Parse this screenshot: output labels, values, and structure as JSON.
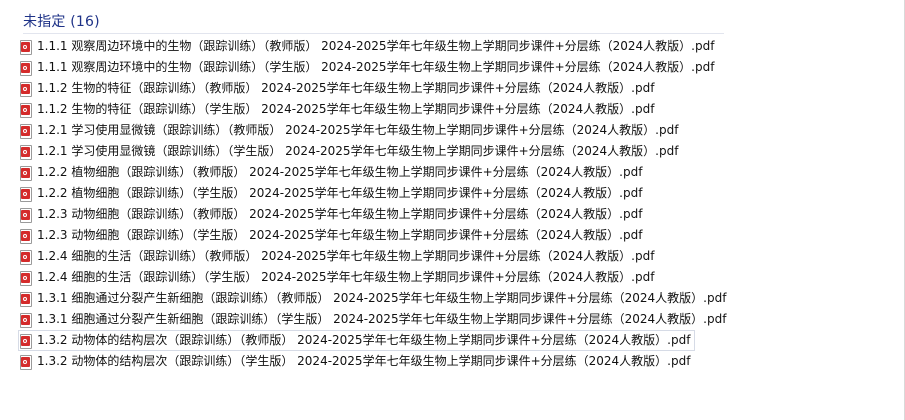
{
  "group": {
    "title": "未指定 (16)"
  },
  "files": [
    {
      "name": "1.1.1 观察周边环境中的生物（跟踪训练）（教师版） 2024-2025学年七年级生物上学期同步课件+分层练（2024人教版）.pdf",
      "icon": "pdf-icon"
    },
    {
      "name": "1.1.1 观察周边环境中的生物（跟踪训练）（学生版） 2024-2025学年七年级生物上学期同步课件+分层练（2024人教版）.pdf",
      "icon": "pdf-icon"
    },
    {
      "name": "1.1.2 生物的特征（跟踪训练）（教师版） 2024-2025学年七年级生物上学期同步课件+分层练（2024人教版）.pdf",
      "icon": "pdf-icon"
    },
    {
      "name": "1.1.2 生物的特征（跟踪训练）（学生版） 2024-2025学年七年级生物上学期同步课件+分层练（2024人教版）.pdf",
      "icon": "pdf-icon"
    },
    {
      "name": "1.2.1 学习使用显微镜（跟踪训练）（教师版） 2024-2025学年七年级生物上学期同步课件+分层练（2024人教版）.pdf",
      "icon": "pdf-icon"
    },
    {
      "name": "1.2.1 学习使用显微镜（跟踪训练）（学生版） 2024-2025学年七年级生物上学期同步课件+分层练（2024人教版）.pdf",
      "icon": "pdf-icon"
    },
    {
      "name": "1.2.2 植物细胞（跟踪训练）（教师版） 2024-2025学年七年级生物上学期同步课件+分层练（2024人教版）.pdf",
      "icon": "pdf-icon"
    },
    {
      "name": "1.2.2 植物细胞（跟踪训练）（学生版） 2024-2025学年七年级生物上学期同步课件+分层练（2024人教版）.pdf",
      "icon": "pdf-icon"
    },
    {
      "name": "1.2.3 动物细胞（跟踪训练）（教师版） 2024-2025学年七年级生物上学期同步课件+分层练（2024人教版）.pdf",
      "icon": "pdf-icon"
    },
    {
      "name": "1.2.3 动物细胞（跟踪训练）（学生版） 2024-2025学年七年级生物上学期同步课件+分层练（2024人教版）.pdf",
      "icon": "pdf-icon"
    },
    {
      "name": "1.2.4 细胞的生活（跟踪训练）（教师版） 2024-2025学年七年级生物上学期同步课件+分层练（2024人教版）.pdf",
      "icon": "pdf-icon"
    },
    {
      "name": "1.2.4 细胞的生活（跟踪训练）（学生版） 2024-2025学年七年级生物上学期同步课件+分层练（2024人教版）.pdf",
      "icon": "pdf-icon"
    },
    {
      "name": "1.3.1 细胞通过分裂产生新细胞（跟踪训练）（教师版） 2024-2025学年七年级生物上学期同步课件+分层练（2024人教版）.pdf",
      "icon": "pdf-icon"
    },
    {
      "name": "1.3.1 细胞通过分裂产生新细胞（跟踪训练）（学生版） 2024-2025学年七年级生物上学期同步课件+分层练（2024人教版）.pdf",
      "icon": "pdf-icon"
    },
    {
      "name": "1.3.2 动物体的结构层次（跟踪训练）（教师版） 2024-2025学年七年级生物上学期同步课件+分层练（2024人教版）.pdf",
      "icon": "pdf-icon",
      "focused": true
    },
    {
      "name": "1.3.2 动物体的结构层次（跟踪训练）（学生版） 2024-2025学年七年级生物上学期同步课件+分层练（2024人教版）.pdf",
      "icon": "pdf-icon"
    }
  ],
  "colors": {
    "group_title": "#1e3287",
    "pdf_badge": "#d42b2b",
    "focus_border": "#d6dbe6"
  }
}
